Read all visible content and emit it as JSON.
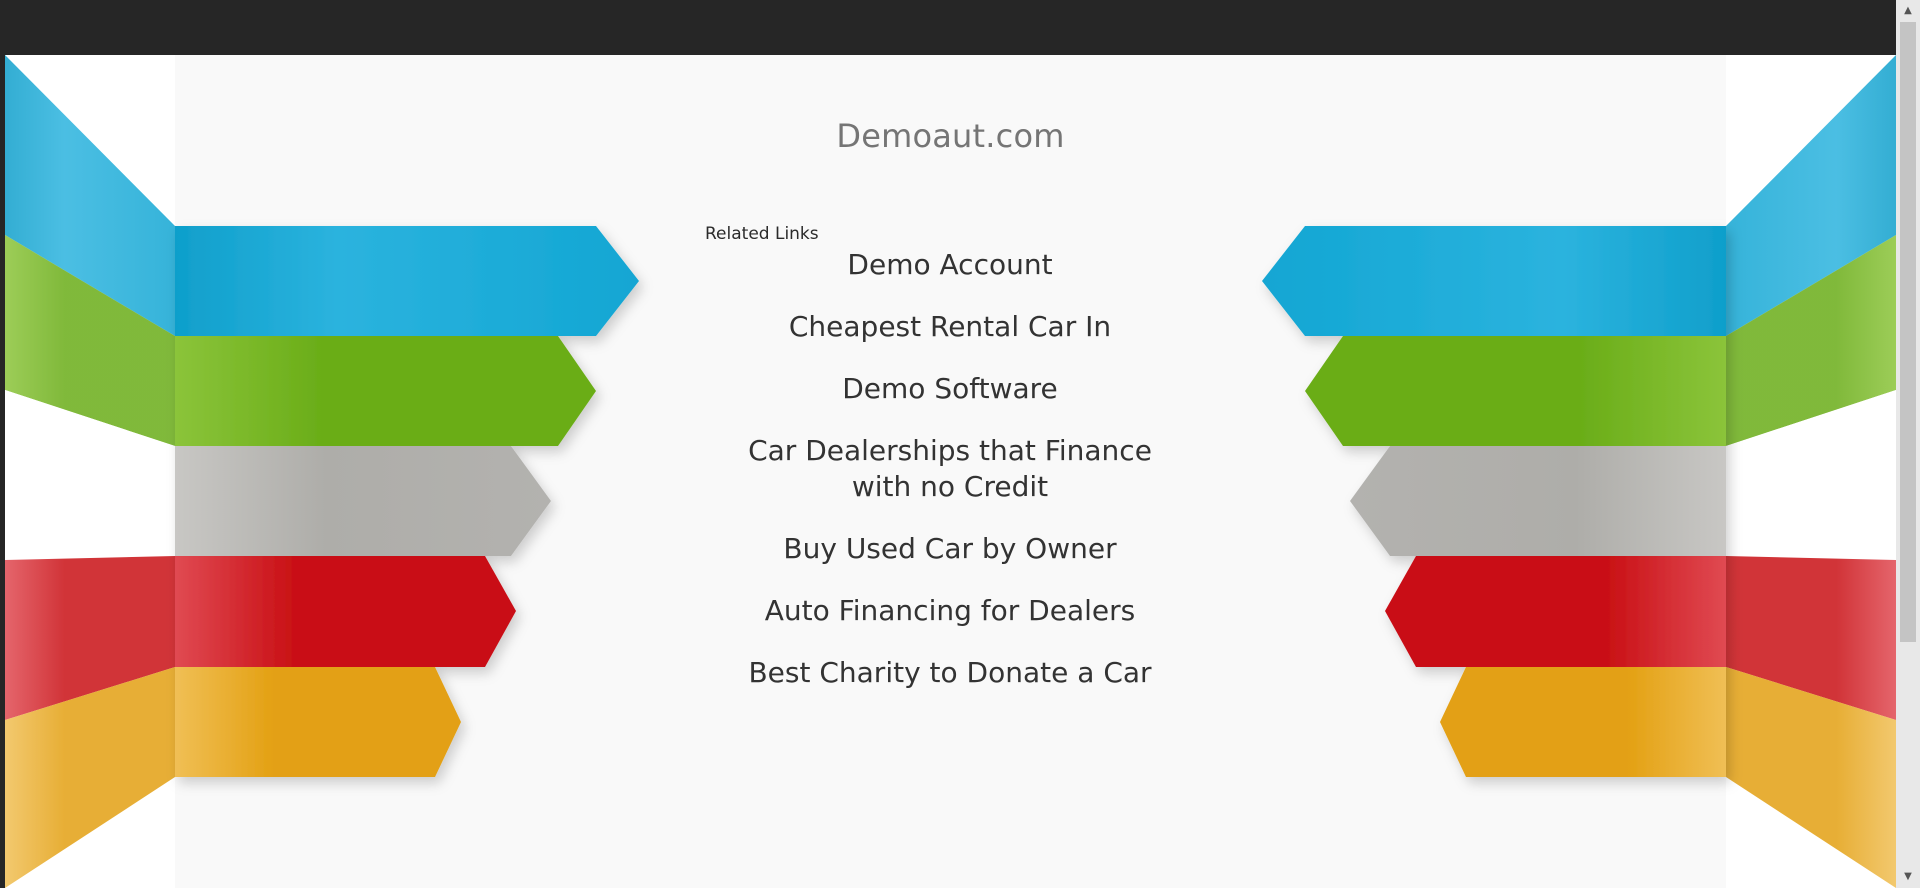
{
  "site": {
    "title": "Demoaut.com"
  },
  "related": {
    "heading": "Related Links",
    "links": [
      "Demo Account",
      "Cheapest Rental Car In",
      "Demo Software",
      "Car Dealerships that Finance with no Credit",
      "Buy Used Car by Owner",
      "Auto Financing for Dealers",
      "Best Charity to Donate a Car"
    ]
  },
  "colors": {
    "blue": "#12a6d3",
    "green": "#6aad18",
    "gray": "#b0afac",
    "red": "#c91015",
    "orange": "#e3a012",
    "panel": "#f9f9f9",
    "frame": "#262626"
  },
  "scrollbar": {
    "up_icon": "triangle-up-icon",
    "down_icon": "triangle-down-icon"
  }
}
